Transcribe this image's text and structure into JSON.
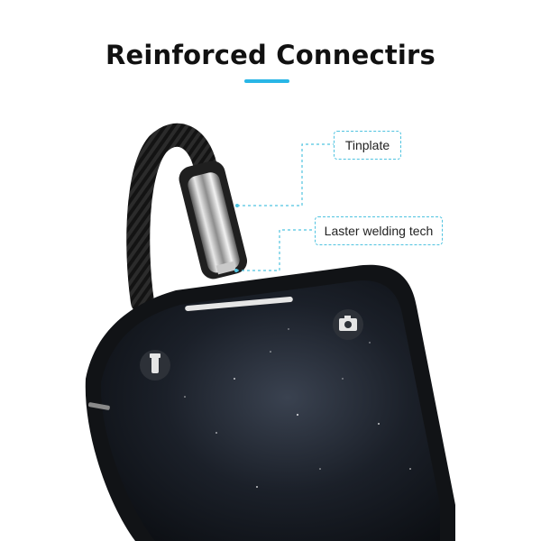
{
  "headline": "Reinforced Connectirs",
  "accent_color": "#29b6e6",
  "callouts": {
    "tinplate": "Tinplate",
    "laser_welding": "Laster welding tech"
  },
  "icons": {
    "left": "flashlight-icon",
    "right": "camera-icon"
  }
}
